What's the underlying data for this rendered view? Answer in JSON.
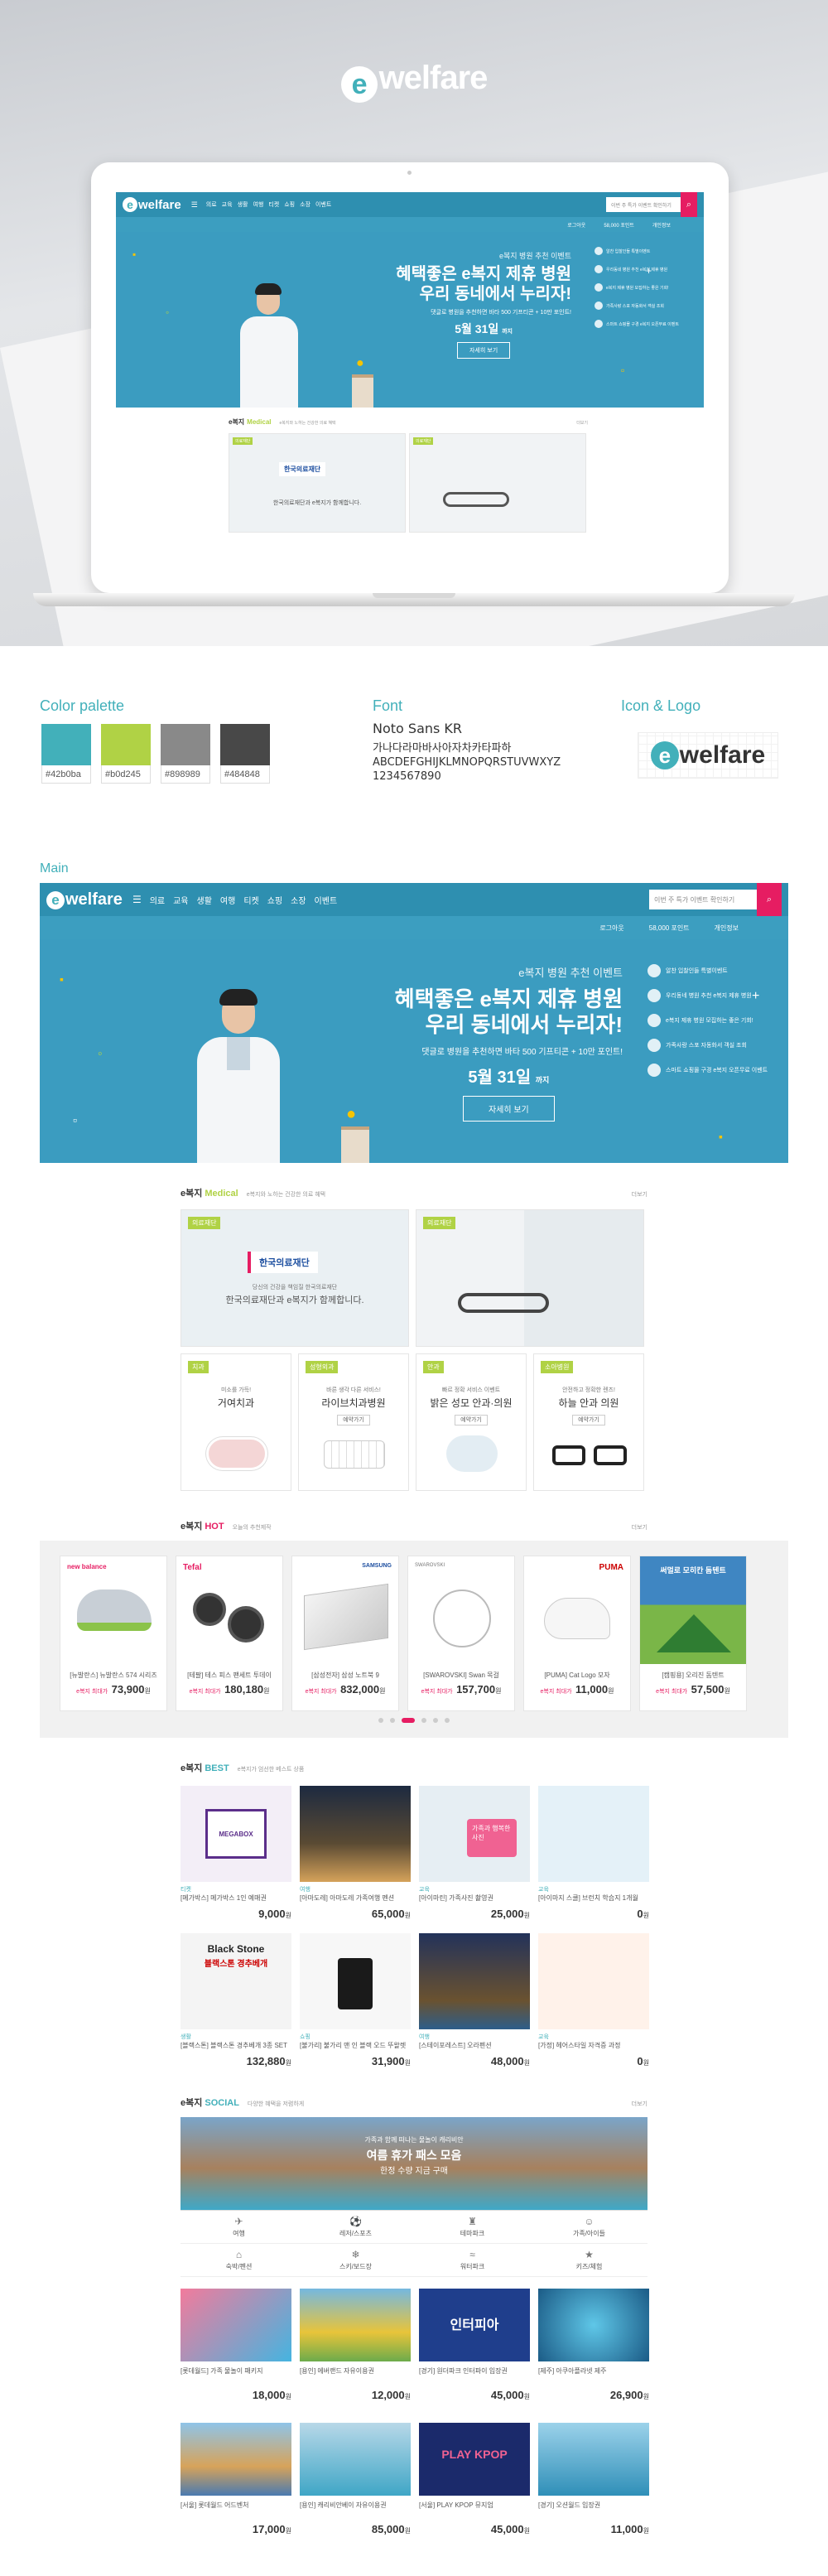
{
  "brand": {
    "name": "welfare",
    "e": "e"
  },
  "site": {
    "menu_icon": "hamburger-icon",
    "nav": [
      "의료",
      "교육",
      "생활",
      "여행",
      "티켓",
      "쇼핑",
      "소장",
      "이벤트"
    ],
    "search_placeholder": "이번 주 특가 이벤트 확인하기",
    "sub": [
      "로그아웃",
      "58,000 포인트",
      "개인정보"
    ],
    "banner": {
      "top": "e복지 병원 추천 이벤트",
      "title1": "혜택좋은 e복지 제휴 병원",
      "title2": "우리 동네에서 누리자!",
      "desc": "댓글로 병원을 추천하면 바타 500 기프티콘 + 10만 포인트!",
      "date": "5월 31일",
      "date_suffix": "까지",
      "button": "자세히 보기",
      "side": [
        "알찬 입찰인들 특별이벤트",
        "우리동네 병원 추천 e복지 제휴 병원",
        "e복지 제휴 병원 모집하는 좋은 기회!",
        "가족사랑 스포 자동화서 객실 조회",
        "스마트 쇼핑몰 구경 e복지 오픈무료 이벤트"
      ]
    }
  },
  "laptop_section": {
    "medical_title": "e복지",
    "medical_sub": "Medical",
    "medical_desc": "e복지와 노하는 건강한 의료 혜택",
    "more": "더보기"
  },
  "palette": {
    "label": "Color palette",
    "colors": [
      {
        "hex": "#42b0ba",
        "label": "#42b0ba"
      },
      {
        "hex": "#b0d245",
        "label": "#b0d245"
      },
      {
        "hex": "#898989",
        "label": "#898989"
      },
      {
        "hex": "#484848",
        "label": "#484848"
      }
    ]
  },
  "font": {
    "label": "Font",
    "name": "Noto Sans KR",
    "line1": "가나다라마바사아자차카타파하",
    "line2": "ABCDEFGHIJKLMNOPQRSTUVWXYZ",
    "line3": "1234567890"
  },
  "icon_logo": {
    "label": "Icon & Logo"
  },
  "main": {
    "label": "Main",
    "medical": {
      "title": "e복지",
      "sub": "Medical",
      "desc": "e복지와 노하는 건강한 의료 혜택",
      "more": "더보기",
      "big1_tag": "의료재단",
      "big1_logo": "한국의료재단",
      "big1_line": "한국의료재단과 e복지가 함께합니다.",
      "big1_small": "당신의 건강을 책임질 한국의료재단",
      "big2_tag": "의료재단",
      "small": [
        {
          "tag": "치과",
          "name": "거여치과",
          "line": "미소를 가득!"
        },
        {
          "tag": "성형외과",
          "name": "라이브치과병원",
          "line": "바른 생각 다른 서비스!"
        },
        {
          "tag": "안과",
          "name": "밝은 성모 안과·의원",
          "line": "빠르 정확 서비스 이벤트"
        },
        {
          "tag": "소아병원",
          "name": "하늘 안과 의원",
          "line": "안전하고 정확한 렌즈!"
        }
      ],
      "small_btn": "예약가기"
    },
    "hot": {
      "title": "e복지",
      "sub": "HOT",
      "desc": "오늘의 추천제작",
      "more": "더보기",
      "items": [
        {
          "brand": "new balance",
          "name": "[뉴발란스] 뉴발란스 574 시리즈",
          "pl": "e복지 최대가",
          "price": "73,900"
        },
        {
          "brand": "Tefal",
          "name": "[테팔] 테스 피스 팬세트 투데이",
          "pl": "e복지 최대가",
          "price": "180,180"
        },
        {
          "brand": "SAMSUNG",
          "name": "[삼성전자] 삼성 노트북 9",
          "pl": "e복지 최대가",
          "price": "832,000"
        },
        {
          "brand": "SWAROVSKI",
          "name": "[SWAROVSKI] Swan 목걸",
          "pl": "e복지 최대가",
          "price": "157,700"
        },
        {
          "brand": "PUMA",
          "name": "[PUMA] Cat Logo 모자",
          "pl": "e복지 최대가",
          "price": "11,000"
        },
        {
          "brand": "",
          "name": "[캠핑용] 오리진 돔텐트",
          "pl": "e복지 최대가",
          "price": "57,500"
        }
      ],
      "won": "원",
      "promo": "써멀로 모히칸 돔텐트"
    },
    "best": {
      "title": "e복지",
      "sub": "BEST",
      "desc": "e복지가 엄선한 베스트 상품",
      "more": "더보기",
      "items": [
        {
          "cat": "티켓",
          "name": "[메가박스] 메가박스 1인 예매권",
          "price": "9,000"
        },
        {
          "cat": "여행",
          "name": "[아마도레] 아마도레 가족여행 펜션",
          "price": "65,000"
        },
        {
          "cat": "교육",
          "name": "[아이마린] 가족사진 촬영권",
          "price": "25,000"
        },
        {
          "cat": "교육",
          "name": "[아이마지 스쿨] 브런치 학습지 1개월",
          "price": "0"
        },
        {
          "cat": "생활",
          "name": "[블랙스톤] 블랙스톤 경추베개 3종 SET",
          "price": "132,880"
        },
        {
          "cat": "쇼핑",
          "name": "[불가리] 불가리 맨 인 블랙 오드 뚜왈렛",
          "price": "31,900"
        },
        {
          "cat": "여행",
          "name": "[스테이포레스트] 오라펜션",
          "price": "48,000"
        },
        {
          "cat": "교육",
          "name": "[가정] 헤어스타일 자격증 과정",
          "price": "0"
        }
      ],
      "mega": "MEGABOX",
      "blackstone": "Black Stone",
      "blackstone_kr": "블랙스톤 경추베개",
      "kid_text": "가족과 행복한 사진"
    },
    "social": {
      "title": "e복지",
      "sub": "SOCIAL",
      "desc": "다양한 혜택을 저렴하게",
      "more": "더보기",
      "banner_line1": "가족과 함께 떠나는 물놀이 캐리비안",
      "banner_line2": "여름 휴가 패스 모음",
      "banner_line3": "한정 수량 지금 구매",
      "cats": [
        "여행",
        "레저/스포츠",
        "테마파크",
        "가족/아이들",
        "숙박/펜션",
        "스키/보드장",
        "워터파크",
        "키즈/체험"
      ],
      "items": [
        {
          "name": "[롯데월드] 가족 물놀이 패키지",
          "price": "18,000"
        },
        {
          "name": "[용인] 에버랜드 자유이용권",
          "price": "12,000"
        },
        {
          "name": "[경기] 원더파크 인터파이 입장권",
          "price": "45,000"
        },
        {
          "name": "[제주] 아쿠아플라넷 제주",
          "price": "26,900"
        },
        {
          "name": "[서울] 롯데월드 어드벤처",
          "price": "17,000"
        },
        {
          "name": "[용인] 캐리비안베이 자유이용권",
          "price": "85,000"
        },
        {
          "name": "[서울] PLAY KPOP 뮤지엄",
          "price": "45,000"
        },
        {
          "name": "[경기] 오션월드 입장권",
          "price": "11,000"
        }
      ],
      "interpia": "인터피아",
      "playkpop": "PLAY KPOP"
    }
  }
}
